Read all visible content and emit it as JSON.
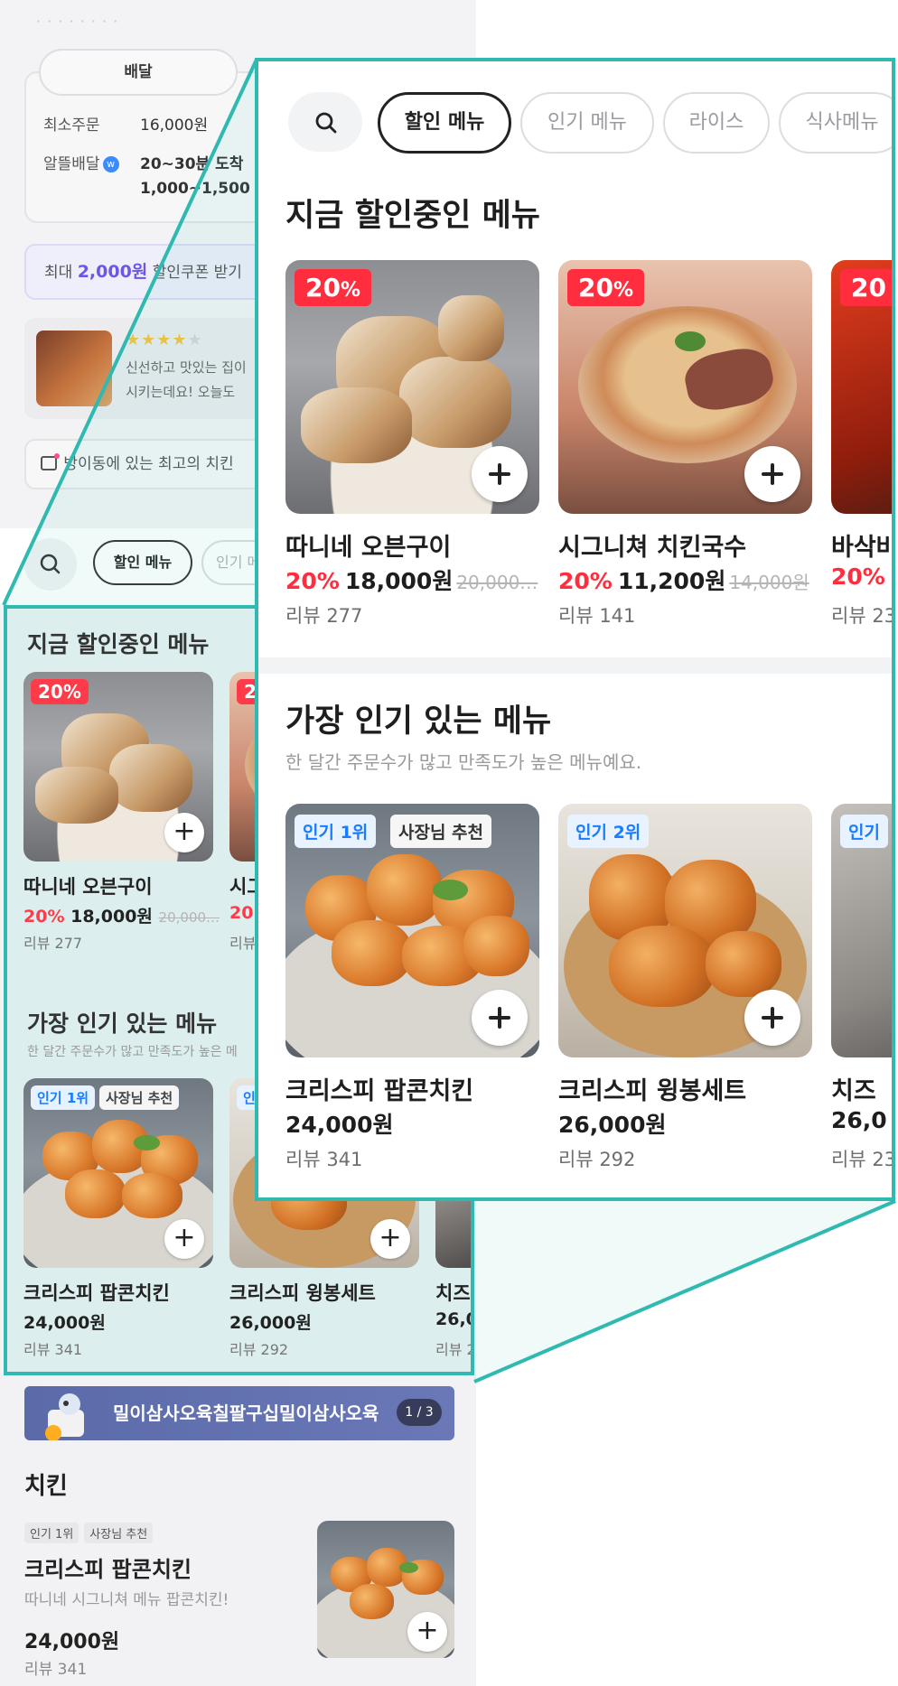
{
  "background": {
    "delivery_tab": "배달",
    "info": {
      "min_order_label": "최소주문",
      "min_order_value": "16,000원",
      "saver_label": "알뜰배달",
      "saver_time": "20~30분 도착",
      "saver_fee": "1,000~1,500"
    },
    "coupon": {
      "prefix": "최대",
      "amount": "2,000원",
      "suffix": "할인쿠폰 받기"
    },
    "review": {
      "stars": "★★★★",
      "star_empty": "★",
      "text_line1": "신선하고 맛있는 집이",
      "text_line2": "시키는데요! 오늘도"
    },
    "tip": "방이동에 있는 최고의 치킨",
    "tabs": {
      "active": "할인 메뉴",
      "next": "인기 메"
    },
    "highlight": {
      "discount_section_title": "지금 할인중인 메뉴",
      "discount_items": [
        {
          "badge": "20%",
          "title": "따니네 오븐구이",
          "pct": "20%",
          "price": "18,000원",
          "original": "20,000…",
          "review": "리뷰 277"
        },
        {
          "badge": "2",
          "title": "시그",
          "pct": "20",
          "price": "",
          "original": "",
          "review": "리뷰"
        }
      ],
      "popular_section_title": "가장 인기 있는 메뉴",
      "popular_section_sub": "한 달간 주문수가 많고 만족도가 높은 메",
      "popular_items": [
        {
          "badge1": "인기 1위",
          "badge2": "사장님 추천",
          "title": "크리스피 팝콘치킨",
          "price": "24,000원",
          "review": "리뷰 341"
        },
        {
          "badge1": "인",
          "badge2": "",
          "title": "크리스피 윙봉세트",
          "price": "26,000원",
          "review": "리뷰 292"
        },
        {
          "badge1": "",
          "badge2": "",
          "title": "치즈",
          "price": "26,0",
          "review": "리뷰 2"
        }
      ]
    },
    "banner": {
      "text": "밀이삼사오육칠팔구십밀이삼사오육",
      "pager": "1 / 3"
    },
    "category": {
      "title": "치킨",
      "item": {
        "badge1": "인기 1위",
        "badge2": "사장님 추천",
        "title": "크리스피 팝콘치킨",
        "desc": "따니네 시그니쳐 메뉴 팝콘치킨!",
        "price": "24,000원",
        "review": "리뷰 341"
      }
    }
  },
  "zoom": {
    "tabs": [
      "할인 메뉴",
      "인기 메뉴",
      "라이스",
      "식사메뉴"
    ],
    "discount": {
      "title": "지금 할인중인 메뉴",
      "items": [
        {
          "badge_num": "20",
          "badge_unit": "%",
          "title": "따니네 오븐구이",
          "pct": "20%",
          "price": "18,000원",
          "original": "20,000…",
          "review": "리뷰 277"
        },
        {
          "badge_num": "20",
          "badge_unit": "%",
          "title": "시그니쳐 치킨국수",
          "pct": "20%",
          "price": "11,200원",
          "original": "14,000원",
          "review": "리뷰 141"
        },
        {
          "badge_num": "20",
          "badge_unit": "",
          "title": "바삭바",
          "pct": "20%",
          "price": "",
          "original": "",
          "review": "리뷰 23"
        }
      ]
    },
    "popular": {
      "title": "가장 인기 있는 메뉴",
      "subtitle": "한 달간 주문수가 많고 만족도가 높은 메뉴예요.",
      "items": [
        {
          "badge1": "인기 1위",
          "badge2": "사장님 추천",
          "title": "크리스피 팝콘치킨",
          "price": "24,000원",
          "review": "리뷰 341"
        },
        {
          "badge1": "인기 2위",
          "badge2": "",
          "title": "크리스피 윙봉세트",
          "price": "26,000원",
          "review": "리뷰 292"
        },
        {
          "badge1": "인기",
          "badge2": "",
          "title": "치즈 ",
          "price": "26,0",
          "review": "리뷰 23"
        }
      ]
    }
  },
  "colors": {
    "accent_teal": "#2fb9b0",
    "discount_red": "#ff2d3d",
    "rank_blue": "#1a7cff",
    "coupon_purple": "#6c55e8"
  },
  "icons": [
    "search-icon",
    "plus-icon",
    "star-icon",
    "chat-icon",
    "w-badge-icon"
  ]
}
